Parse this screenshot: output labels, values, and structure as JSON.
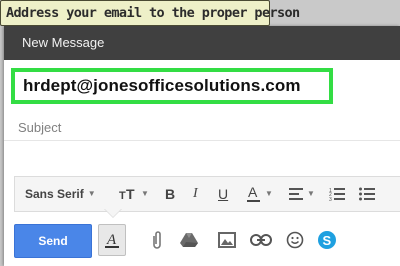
{
  "tooltip": {
    "text": "Address your email to the proper person"
  },
  "compose": {
    "title": "New Message",
    "to_value": "hrdept@jonesofficesolutions.com",
    "subject_placeholder": "Subject"
  },
  "formatting_toolbar": {
    "font_family": "Sans Serif",
    "items": [
      "font-size-icon",
      "bold-icon",
      "italic-icon",
      "underline-icon",
      "text-color-icon",
      "align-icon",
      "numbered-list-icon",
      "bulleted-list-icon"
    ]
  },
  "bottom_toolbar": {
    "send_label": "Send",
    "icons": [
      "formatting-options-icon",
      "attach-icon",
      "drive-icon",
      "insert-photo-icon",
      "insert-link-icon",
      "emoji-icon",
      "skype-icon"
    ]
  },
  "colors": {
    "header": "#404040",
    "highlight": "#33dd44",
    "send": "#4a86e8",
    "tooltip_bg": "#eef0c8",
    "skype": "#1ea0e0"
  }
}
